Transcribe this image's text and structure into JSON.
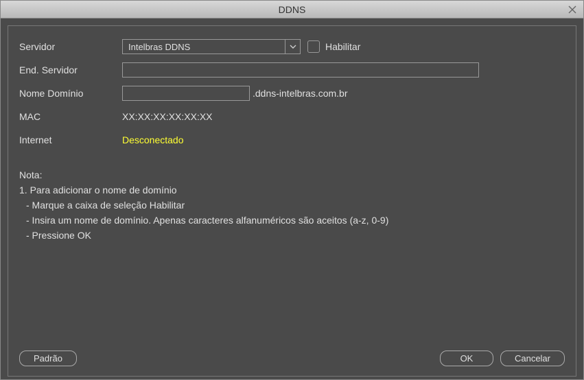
{
  "window": {
    "title": "DDNS"
  },
  "form": {
    "server_label": "Servidor",
    "server_value": "Intelbras DDNS",
    "enable_label": "Habilitar",
    "endpoint_label": "End. Servidor",
    "endpoint_value": "",
    "domain_label": "Nome Domínio",
    "domain_value": "",
    "domain_suffix": ".ddns-intelbras.com.br",
    "mac_label": "MAC",
    "mac_value": "XX:XX:XX:XX:XX:XX",
    "internet_label": "Internet",
    "internet_status": "Desconectado"
  },
  "note": {
    "heading": "Nota:",
    "line1": "1. Para adicionar o nome de domínio",
    "bullet1": "- Marque a caixa de seleção Habilitar",
    "bullet2": "- Insira um nome de domínio. Apenas caracteres alfanuméricos são aceitos (a-z, 0-9)",
    "bullet3": "- Pressione OK"
  },
  "buttons": {
    "default": "Padrão",
    "ok": "OK",
    "cancel": "Cancelar"
  }
}
